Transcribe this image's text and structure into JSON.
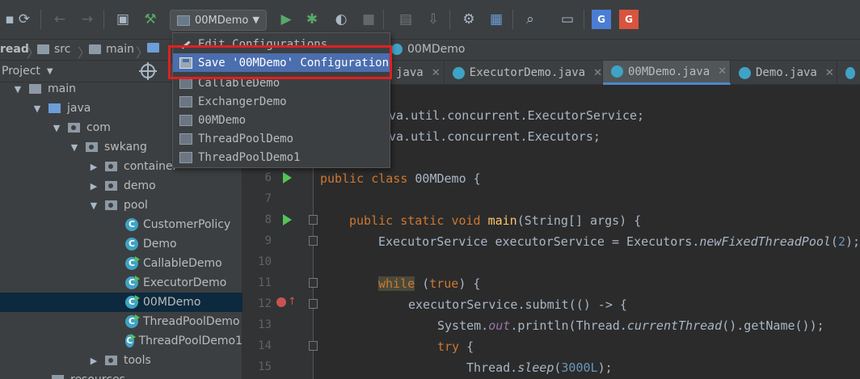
{
  "toolbar": {
    "run_config": "00MDemo",
    "icons": [
      "save-all-icon",
      "sync-icon",
      "back-icon",
      "forward-icon",
      "window-icon",
      "build-hammer-icon",
      "run-icon",
      "debug-icon",
      "coverage-icon",
      "stop-icon",
      "attach-icon",
      "download-icon",
      "wrench-icon",
      "project-structure-icon",
      "search-icon",
      "terminal-icon",
      "google-translate-icon",
      "google-translate-2-icon"
    ]
  },
  "breadcrumb": [
    "read",
    "src",
    "main",
    "00MDemo"
  ],
  "dropdown": {
    "items": [
      "Edit Configurations...",
      "Save '00MDemo' Configuration",
      "CallableDemo",
      "ExchangerDemo",
      "00MDemo",
      "ThreadPoolDemo",
      "ThreadPoolDemo1"
    ]
  },
  "project": {
    "title": "Project",
    "tree": [
      "main",
      "java",
      "com",
      "swkang",
      "container",
      "demo",
      "pool",
      "CustomerPolicy",
      "Demo",
      "CallableDemo",
      "ExecutorDemo",
      "00MDemo",
      "ThreadPoolDemo",
      "ThreadPoolDemo1",
      "tools",
      "resources"
    ]
  },
  "tabs": [
    "java",
    "ExecutorDemo.java",
    "00MDemo.java",
    "Demo.java"
  ],
  "editor": {
    "line_numbers": [
      "6",
      "7",
      "8",
      "9",
      "10",
      "11",
      "12",
      "13",
      "14",
      "15"
    ],
    "import1": "va.util.concurrent.ExecutorService;",
    "import2": "va.util.concurrent.Executors;",
    "kw_public": "public",
    "kw_class": "class",
    "kw_static": "static",
    "kw_void": "void",
    "kw_while": "while",
    "kw_true": "true",
    "kw_try": "try",
    "class_name": "00MDemo",
    "brace_open": "{",
    "main_name": "main",
    "main_params": "(String[] args) {",
    "exec_decl": "ExecutorService executorService = Executors.",
    "new_pool": "newFixedThreadPool",
    "paren_open": "(",
    "pool_size": "2",
    "paren_close_semi": ");",
    "while_paren_open": "(",
    "while_paren_close": ") {",
    "submit_call": "executorService.submit(() -> {",
    "sysout_1": "System.",
    "sysout_out": "out",
    "sysout_2": ".println(Thread.",
    "current_thread": "currentThread",
    "sysout_3": "().getName());",
    "try_brace": " {",
    "sleep_1": "Thread.",
    "sleep_fn": "sleep",
    "sleep_2": "(",
    "sleep_val": "3000L",
    "sleep_3": ");"
  }
}
